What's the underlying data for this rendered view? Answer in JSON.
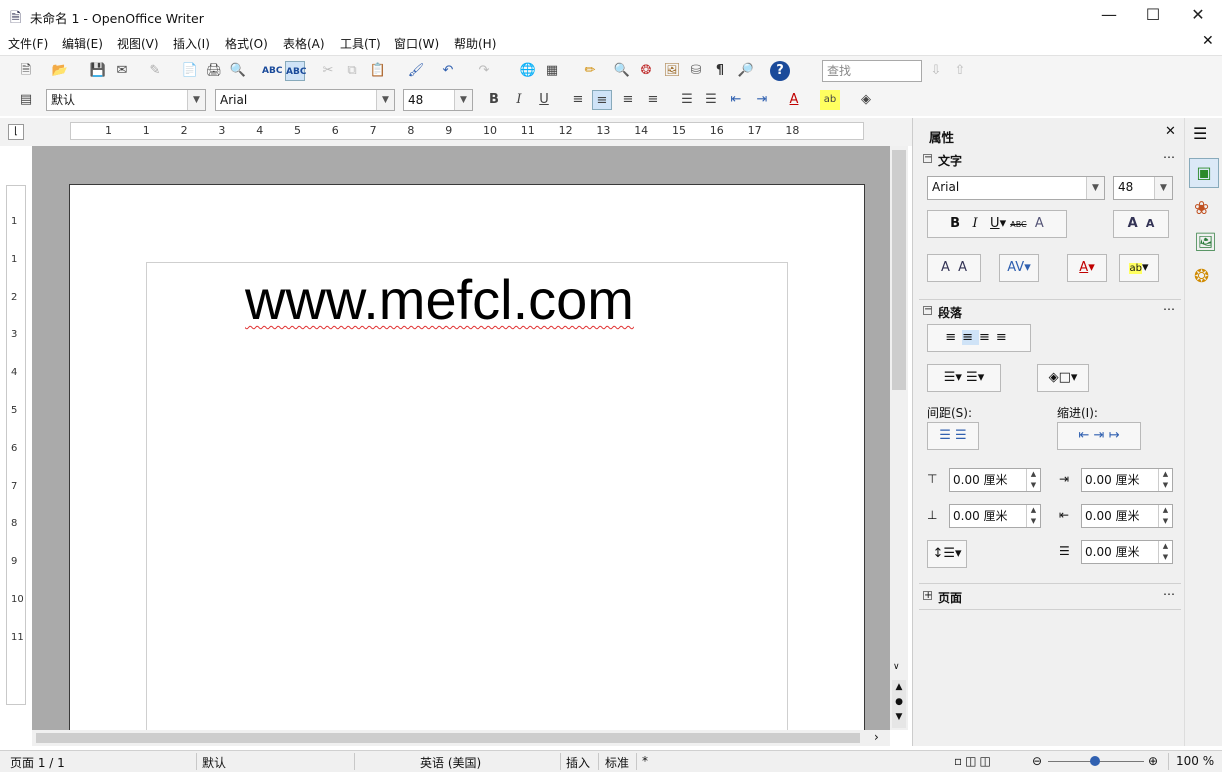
{
  "window": {
    "title": "未命名 1 - OpenOffice Writer"
  },
  "menu": [
    "文件(F)",
    "编辑(E)",
    "视图(V)",
    "插入(I)",
    "格式(O)",
    "表格(A)",
    "工具(T)",
    "窗口(W)",
    "帮助(H)"
  ],
  "toolbar": {
    "find_placeholder": "查找"
  },
  "format_bar": {
    "style": "默认",
    "font": "Arial",
    "size": "48"
  },
  "ruler": {
    "h_ticks": [
      "1",
      "1",
      "2",
      "3",
      "4",
      "5",
      "6",
      "7",
      "8",
      "9",
      "10",
      "11",
      "12",
      "13",
      "14",
      "15",
      "16",
      "17",
      "18"
    ],
    "v_ticks": [
      "1",
      "1",
      "2",
      "3",
      "4",
      "5",
      "6",
      "7",
      "8",
      "9",
      "10",
      "11"
    ]
  },
  "document": {
    "text": "www.mefcl.com"
  },
  "sidebar": {
    "title": "属性",
    "text_section": {
      "title": "文字",
      "font": "Arial",
      "size": "48"
    },
    "para_section": {
      "title": "段落",
      "spacing_label": "间距(S):",
      "indent_label": "缩进(I):",
      "above": "0.00 厘米",
      "below": "0.00 厘米",
      "before": "0.00 厘米",
      "after": "0.00 厘米",
      "first": "0.00 厘米"
    },
    "page_section": {
      "title": "页面"
    }
  },
  "status": {
    "page": "页面 1 / 1",
    "style": "默认",
    "language": "英语 (美国)",
    "insert": "插入",
    "mode": "标准",
    "modified": "*",
    "zoom": "100 %"
  }
}
